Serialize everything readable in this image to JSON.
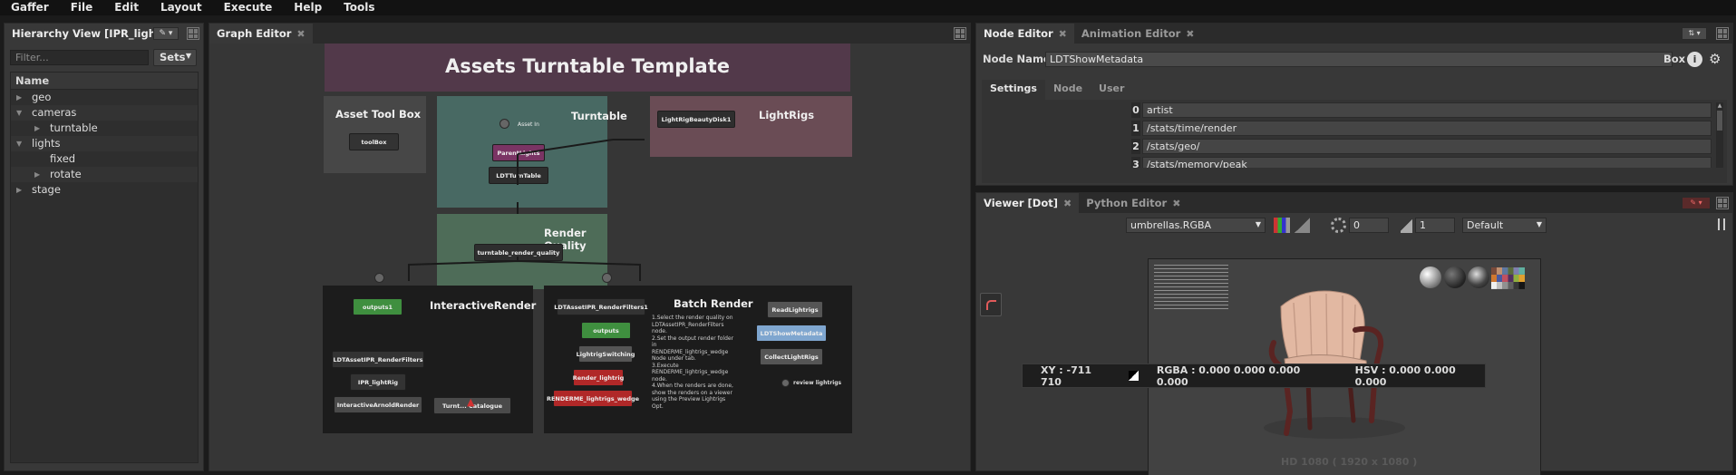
{
  "menubar": {
    "items": [
      "Gaffer",
      "File",
      "Edit",
      "Layout",
      "Execute",
      "Help",
      "Tools"
    ]
  },
  "hierarchy": {
    "tab_title": "Hierarchy View [IPR_lightR",
    "filter_placeholder": "Filter...",
    "sets_label": "Sets",
    "column_header": "Name",
    "rows": [
      {
        "label": "geo",
        "depth": 0,
        "expanded": false
      },
      {
        "label": "cameras",
        "depth": 0,
        "expanded": true
      },
      {
        "label": "turntable",
        "depth": 1,
        "expanded": false
      },
      {
        "label": "lights",
        "depth": 0,
        "expanded": true
      },
      {
        "label": "fixed",
        "depth": 1,
        "expanded": null
      },
      {
        "label": "rotate",
        "depth": 1,
        "expanded": false
      },
      {
        "label": "stage",
        "depth": 0,
        "expanded": false
      }
    ]
  },
  "graph_editor": {
    "tab_title": "Graph Editor",
    "backdrops": {
      "main_title": "Assets Turntable Template",
      "asset_toolbox": "Asset Tool Box",
      "turntable": "Turntable",
      "lightrigs": "LightRigs",
      "render_quality": "Render Quality",
      "interactive_render": "InteractiveRender",
      "batch_render": "Batch Render"
    },
    "nodes": {
      "toolbox": "toolBox",
      "asset_in": "Asset In",
      "parent_lights": "ParentLights",
      "ldt_turntable": "LDTTurnTable",
      "lightrig_beauty": "LightRigBeautyDisk1",
      "render_quality": "turntable_render_quality",
      "outputs1": "outputs1",
      "ipr_filters": "LDTAssetIPR_RenderFilters",
      "ipr_lightrig": "IPR_lightRig",
      "interactive_arnold": "InteractiveArnoldRender",
      "catalogue": "Turnt... Catalogue",
      "batch_filters": "LDTAssetIPR_RenderFilters1",
      "outputs": "outputs",
      "lightrig_switching": "LightrigSwitching",
      "render_lightrig": "Render_lightrig",
      "render_me": "RENDERME_lightrigs_wedge",
      "read_lightrigs": "ReadLightrigs",
      "show_metadata": "LDTShowMetadata",
      "collect_lightrigs": "CollectLightRigs",
      "review_lightrigs": "review lightrigs"
    },
    "batch_note": [
      "1.Select the render quality on",
      "  LDTAssetIPR_RenderFilters node.",
      "2.Set the output render folder in",
      "  RENDERME_lightrigs_wedge",
      "  Node under tab.",
      "3.Execute RENDERME_lightrigs_wedge",
      "  node.",
      "4.When the renders are done,",
      "  show the renders on a viewer",
      "  using the Preview Lightrigs Opt."
    ]
  },
  "node_editor": {
    "tabs": [
      {
        "label": "Node Editor",
        "active": true
      },
      {
        "label": "Animation Editor",
        "active": false
      }
    ],
    "node_name_label": "Node Name",
    "node_name_value": "LDTShowMetadata",
    "node_type": "Box",
    "subtabs": [
      "Settings",
      "Node",
      "User"
    ],
    "vector_rows": [
      {
        "index": "0",
        "value": "artist"
      },
      {
        "index": "1",
        "value": "/stats/time/render"
      },
      {
        "index": "2",
        "value": "/stats/geo/"
      },
      {
        "index": "3",
        "value": "/stats/memory/peak"
      }
    ]
  },
  "viewer": {
    "tabs": [
      {
        "label": "Viewer [Dot]",
        "active": true
      },
      {
        "label": "Python Editor",
        "active": false
      }
    ],
    "channel_select": "umbrellas.RGBA",
    "exposure_value": "0",
    "gamma_value": "1",
    "display_transform": "Default",
    "status": {
      "xy": "XY : -711 710",
      "rgba": "RGBA : 0.000 0.000 0.000 0.000",
      "hsv": "HSV : 0.000 0.000 0.000"
    },
    "format_label": "HD 1080 ( 1920 x 1080 )"
  },
  "colors": {
    "accent_red": "#c0392b",
    "node_green": "#3f8f3f",
    "node_purple": "#7a3464",
    "node_blue": "#7fa6cf",
    "node_red": "#b02828",
    "backdrop_teal": "#4a6e66",
    "backdrop_pink": "#6a4c55",
    "backdrop_green": "#4e6c58"
  }
}
